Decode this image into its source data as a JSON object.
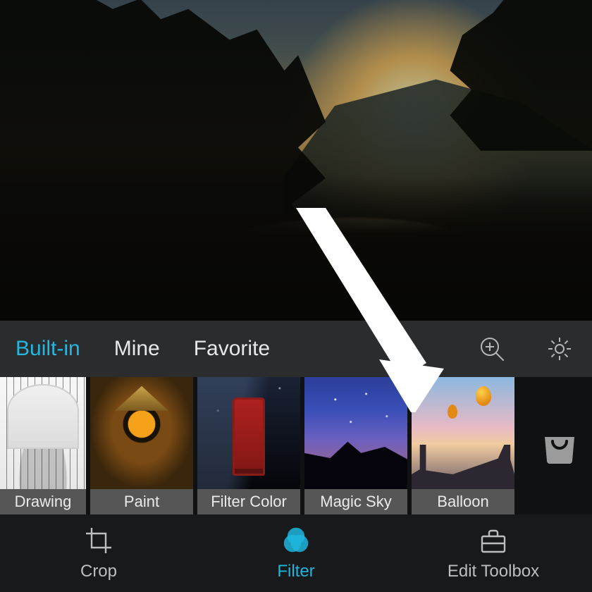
{
  "colors": {
    "accent": "#1fb6de",
    "bg_dark": "#17191b",
    "bg_strip": "#101112",
    "bg_cats": "#2a2c2e",
    "label_bg": "#565656"
  },
  "category_tabs": {
    "items": [
      {
        "label": "Built-in",
        "active": true
      },
      {
        "label": "Mine",
        "active": false
      },
      {
        "label": "Favorite",
        "active": false
      }
    ],
    "zoom_icon": "magnify-plus-icon",
    "settings_icon": "gear-icon"
  },
  "filters": [
    {
      "label": "Drawing",
      "thumb": "drawing"
    },
    {
      "label": "Paint",
      "thumb": "paint"
    },
    {
      "label": "Filter Color",
      "thumb": "filtercolor"
    },
    {
      "label": "Magic Sky",
      "thumb": "magicsky"
    },
    {
      "label": "Balloon",
      "thumb": "balloon"
    }
  ],
  "store_icon": "shopping-bag-icon",
  "annotation": {
    "type": "arrow",
    "points_to_filter": "Balloon"
  },
  "bottom_nav": {
    "items": [
      {
        "label": "Crop",
        "icon": "crop-icon",
        "active": false
      },
      {
        "label": "Filter",
        "icon": "filter-icon",
        "active": true
      },
      {
        "label": "Edit Toolbox",
        "icon": "toolbox-icon",
        "active": false
      }
    ]
  }
}
